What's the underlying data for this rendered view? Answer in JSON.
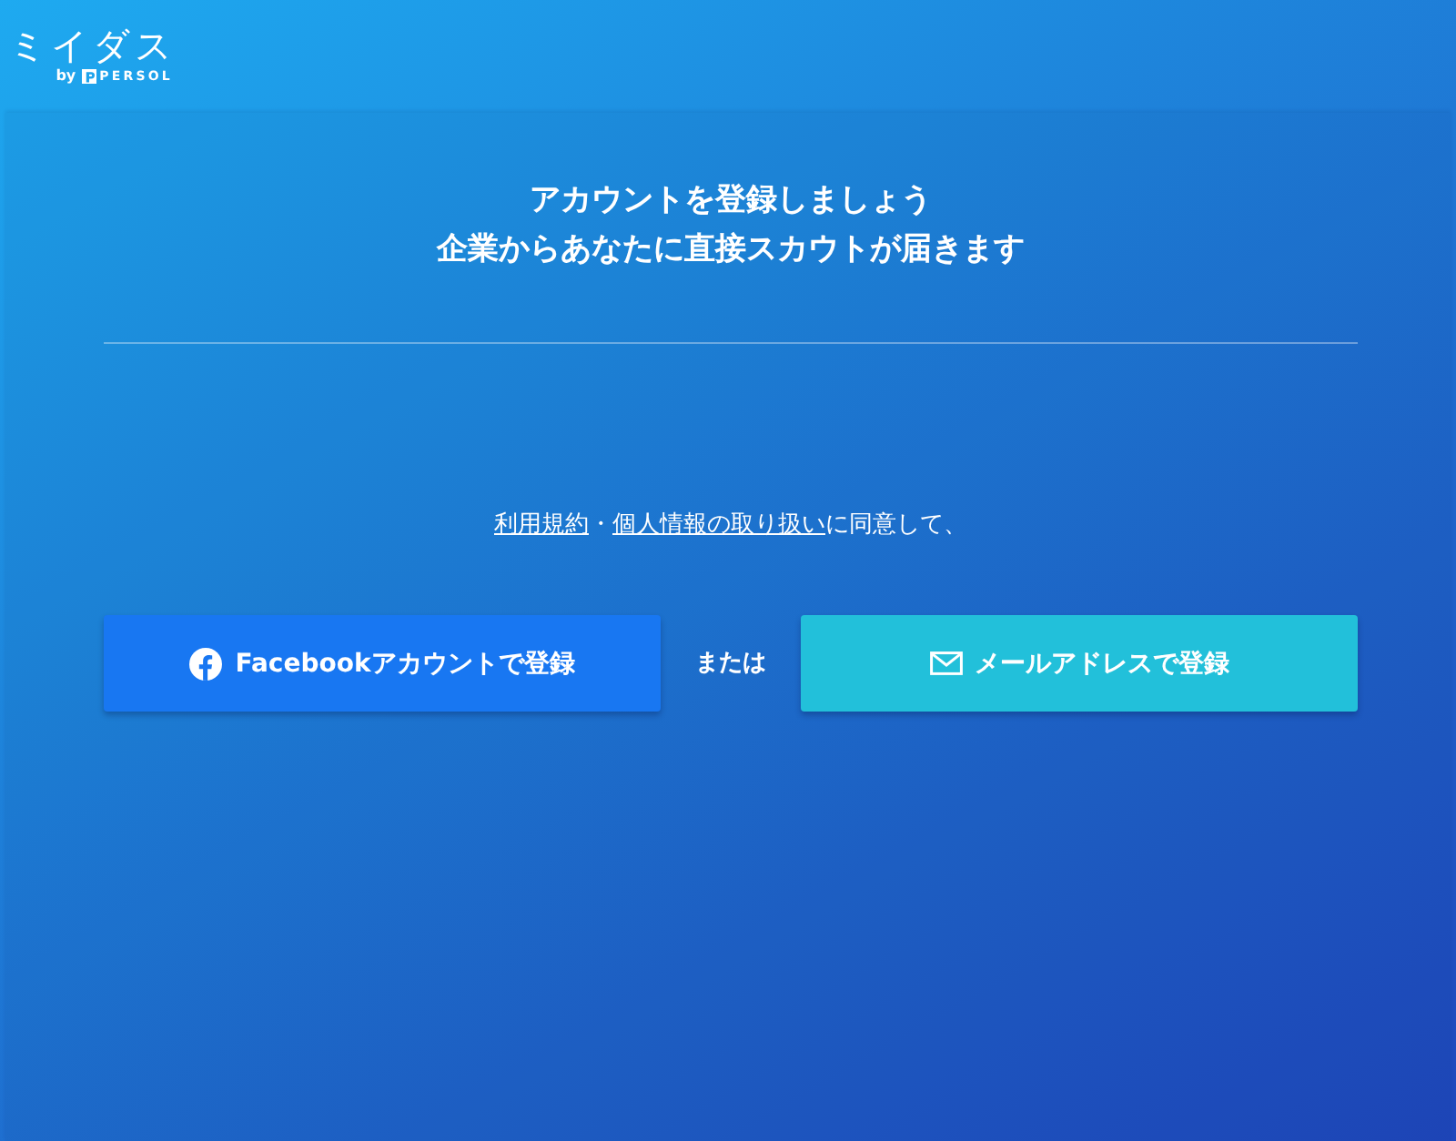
{
  "header": {
    "logo": {
      "name": "ミイダス",
      "byline": "by",
      "brand": "PERSOL"
    }
  },
  "heading": {
    "lines": [
      "アカウントを登録しましょう",
      "企業からあなたに直接スカウトが届きます"
    ]
  },
  "consent": {
    "parts": [
      {
        "kind": "link",
        "text": "利用規約"
      },
      {
        "kind": "text",
        "text": "・"
      },
      {
        "kind": "link",
        "text": "個人情報の取り扱い"
      },
      {
        "kind": "text",
        "text": "に同意して、"
      }
    ]
  },
  "actions": [
    {
      "kind": "facebook",
      "label": "Facebookアカウントで登録"
    },
    {
      "kind": "separator",
      "label": "または"
    },
    {
      "kind": "email",
      "label": "メールアドレスで登録"
    }
  ]
}
